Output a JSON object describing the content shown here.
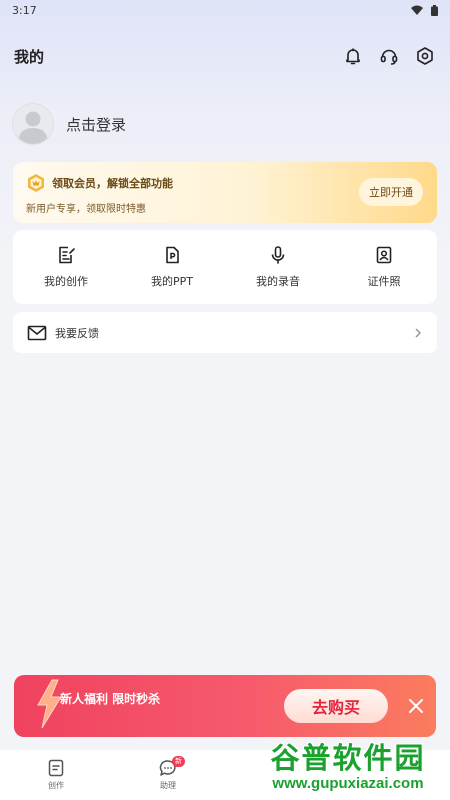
{
  "status_bar": {
    "time": "3:17",
    "icons": [
      "wifi-icon",
      "battery-icon"
    ]
  },
  "header": {
    "title": "我的",
    "icons": [
      "bell-icon",
      "headset-icon",
      "settings-icon"
    ]
  },
  "profile": {
    "login_text": "点击登录"
  },
  "vip": {
    "title": "领取会员，解锁全部功能",
    "subtitle": "新用户专享，领取限时特惠",
    "button": "立即开通",
    "accent": "#ffd98a"
  },
  "grid": {
    "items": [
      {
        "label": "我的创作",
        "icon": "edit-doc-icon"
      },
      {
        "label": "我的PPT",
        "icon": "ppt-file-icon"
      },
      {
        "label": "我的录音",
        "icon": "microphone-icon"
      },
      {
        "label": "证件照",
        "icon": "id-photo-icon"
      }
    ]
  },
  "feedback": {
    "label": "我要反馈",
    "icon": "mail-icon"
  },
  "promo": {
    "text": "新人福利 限时秒杀",
    "button": "去购买",
    "color": "#f0425f"
  },
  "tabbar": {
    "tabs": [
      {
        "label": "创作",
        "icon": "document-icon"
      },
      {
        "label": "助理",
        "icon": "chat-icon",
        "badge": "新"
      }
    ]
  },
  "watermark": {
    "brand": "谷普软件园",
    "url": "www.gupuxiazai.com"
  }
}
